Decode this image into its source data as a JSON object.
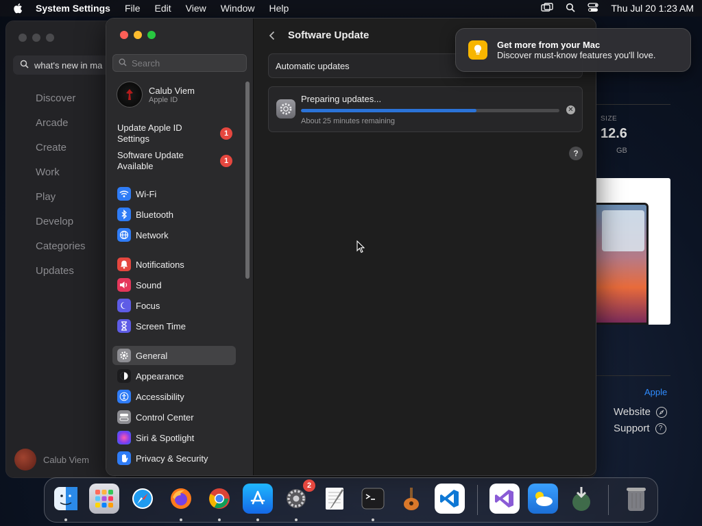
{
  "menubar": {
    "app_name": "System Settings",
    "menus": [
      "File",
      "Edit",
      "View",
      "Window",
      "Help"
    ],
    "clock": "Thu Jul 20  1:23 AM"
  },
  "app_store": {
    "search_value": "what's new in ma",
    "nav": [
      "Discover",
      "Arcade",
      "Create",
      "Work",
      "Play",
      "Develop",
      "Categories",
      "Updates"
    ],
    "user_name": "Calub Viem",
    "size_label": "SIZE",
    "size_value": "12.6",
    "size_unit": "GB",
    "developer_link": "Apple",
    "website_label": "Website",
    "support_label": "Support"
  },
  "settings": {
    "search_placeholder": "Search",
    "profile": {
      "name": "Calub Viem",
      "sub": "Apple ID"
    },
    "notices": [
      {
        "label": "Update Apple ID Settings",
        "badge": "1"
      },
      {
        "label": "Software Update Available",
        "badge": "1"
      }
    ],
    "sidebar_items": [
      {
        "label": "Wi-Fi",
        "icon": "wifi-icon",
        "color": "#2f7cf6"
      },
      {
        "label": "Bluetooth",
        "icon": "bluetooth-icon",
        "color": "#2f7cf6"
      },
      {
        "label": "Network",
        "icon": "globe-icon",
        "color": "#2f7cf6"
      },
      {
        "label": "Notifications",
        "icon": "bell-icon",
        "color": "#e5473f"
      },
      {
        "label": "Sound",
        "icon": "speaker-icon",
        "color": "#e5375b"
      },
      {
        "label": "Focus",
        "icon": "moon-icon",
        "color": "#5e5ce6"
      },
      {
        "label": "Screen Time",
        "icon": "hourglass-icon",
        "color": "#5e5ce6"
      },
      {
        "label": "General",
        "icon": "gear-icon",
        "color": "#8e8e93"
      },
      {
        "label": "Appearance",
        "icon": "appearance-icon",
        "color": "#1c1c1e"
      },
      {
        "label": "Accessibility",
        "icon": "accessibility-icon",
        "color": "#2f7cf6"
      },
      {
        "label": "Control Center",
        "icon": "control-center-icon",
        "color": "#8e8e93"
      },
      {
        "label": "Siri & Spotlight",
        "icon": "siri-icon",
        "color": "#b04ad6"
      },
      {
        "label": "Privacy & Security",
        "icon": "hand-icon",
        "color": "#2f7cf6"
      }
    ],
    "selected_item": "General",
    "main": {
      "title": "Software Update",
      "automatic_updates": "Automatic updates",
      "preparing_title": "Preparing updates...",
      "preparing_sub": "About 25 minutes remaining",
      "progress_fraction": 0.68,
      "help": "?"
    }
  },
  "banner": {
    "title": "Get more from your Mac",
    "body": "Discover must-know features you'll love."
  },
  "dock": {
    "apps": [
      {
        "name": "Finder",
        "icon": "finder-icon",
        "color": "#2b8ae8",
        "running": true
      },
      {
        "name": "Launchpad",
        "icon": "launchpad-icon",
        "color": "#c9c9cf",
        "running": false
      },
      {
        "name": "Safari",
        "icon": "safari-icon",
        "color": "#1f9bf0",
        "running": false
      },
      {
        "name": "Firefox",
        "icon": "firefox-icon",
        "color": "#ff7a1a",
        "running": true
      },
      {
        "name": "Chrome",
        "icon": "chrome-icon",
        "color": "#e9e9e9",
        "running": true
      },
      {
        "name": "App Store",
        "icon": "app-store-icon",
        "color": "#1c8cf5",
        "running": true
      },
      {
        "name": "System Settings",
        "icon": "system-settings-icon",
        "color": "#8e8e93",
        "running": true,
        "badge": "2"
      },
      {
        "name": "TextEdit",
        "icon": "textedit-icon",
        "color": "#f2f2f2",
        "running": false
      },
      {
        "name": "Terminal",
        "icon": "terminal-icon",
        "color": "#1c1c1e",
        "running": true
      },
      {
        "name": "GarageBand",
        "icon": "garageband-icon",
        "color": "#3a3a3c",
        "running": false
      },
      {
        "name": "VS Code",
        "icon": "vscode-icon",
        "color": "#ffffff",
        "running": false
      },
      {
        "name": "Visual Studio",
        "icon": "visual-studio-icon",
        "color": "#ffffff",
        "running": false
      },
      {
        "name": "Weather",
        "icon": "weather-icon",
        "color": "#2a8ff0",
        "running": false
      },
      {
        "name": "Downloads",
        "icon": "downloads-icon",
        "color": "#3a4a5a",
        "running": false
      },
      {
        "name": "Trash",
        "icon": "trash-icon",
        "color": "#8e8e93",
        "running": false
      }
    ]
  }
}
